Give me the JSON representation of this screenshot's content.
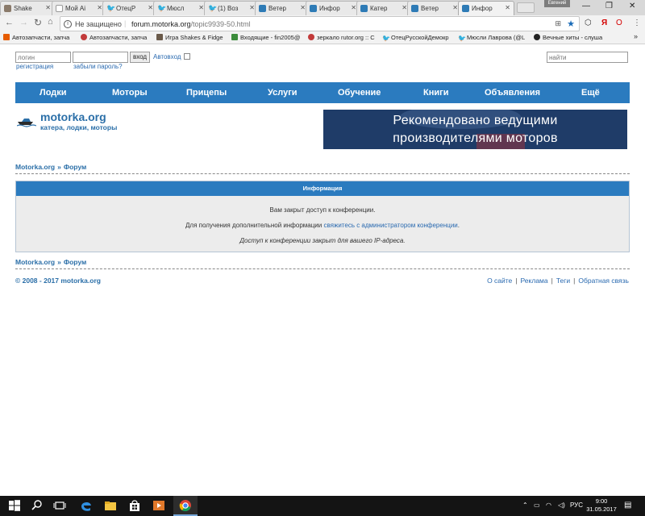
{
  "browser": {
    "tabs": [
      {
        "title": "Shake"
      },
      {
        "title": "Мой Ai"
      },
      {
        "title": "ОтецР"
      },
      {
        "title": "Мюсл"
      },
      {
        "title": "(1) Boз"
      },
      {
        "title": "Ветер"
      },
      {
        "title": "Инфор"
      },
      {
        "title": "Катер"
      },
      {
        "title": "Ветер"
      },
      {
        "title": "Инфор"
      }
    ],
    "user_badge": "Евгений",
    "security_label": "Не защищено",
    "url_domain": "forum.motorka.org",
    "url_path": "/topic9939-50.html",
    "bookmarks": [
      {
        "label": "Автозапчасти, запча"
      },
      {
        "label": "Автозапчасти, запча"
      },
      {
        "label": "Игра Shakes & Fidge"
      },
      {
        "label": "Входящие - fin2005@"
      },
      {
        "label": "зеркало rutor.org :: С"
      },
      {
        "label": "ОтецРусскойДемокр"
      },
      {
        "label": "Мюсли Лаврова (@L"
      },
      {
        "label": "Вечные хиты - слуша"
      }
    ],
    "bookmarks_more": "»"
  },
  "login": {
    "username_placeholder": "логин",
    "password_value": "",
    "submit_label": "вход",
    "autologin_label": "Автовход",
    "register_link": "регистрация",
    "forgot_link": "забыли пароль?",
    "search_placeholder": "найти"
  },
  "nav": {
    "items": [
      "Лодки",
      "Моторы",
      "Прицепы",
      "Услуги",
      "Обучение",
      "Книги",
      "Объявления",
      "Ещё"
    ]
  },
  "logo": {
    "title": "motorka.org",
    "subtitle": "катера, лодки, моторы"
  },
  "banner": {
    "line1": "Рекомендовано ведущими",
    "line2": "производителями моторов"
  },
  "breadcrumb": {
    "home": "Motorka.org",
    "separator": "»",
    "forum": "Форум"
  },
  "info": {
    "heading": "Информация",
    "line1": "Вам закрыт доступ к конференции.",
    "line2_prefix": "Для получения дополнительной информации",
    "line2_link": "свяжитесь с администратором конференции",
    "line2_suffix": ".",
    "line3": "Доступ к конференции закрыт для вашего IP-адреса."
  },
  "footer": {
    "copyright": "© 2008 - 2017 motorka.org",
    "links": [
      "О сайте",
      "Реклама",
      "Теги",
      "Обратная связь"
    ]
  },
  "taskbar": {
    "language": "РУС",
    "time": "9:00",
    "date": "31.05.2017"
  },
  "colors": {
    "accent_blue": "#2b7bbf",
    "link_blue": "#2a6ab0",
    "info_box_bg": "#ececec"
  }
}
